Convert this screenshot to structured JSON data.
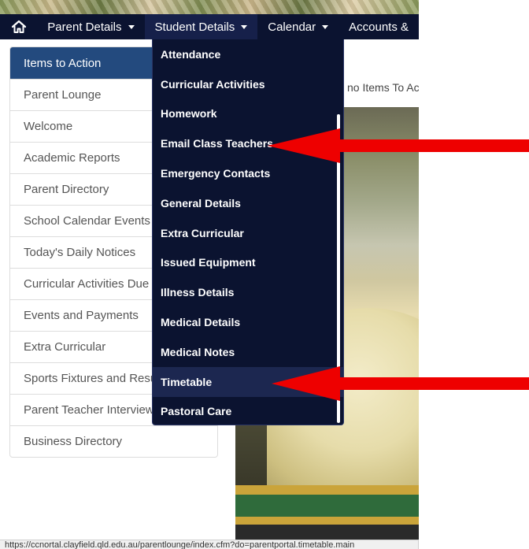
{
  "nav": {
    "items": [
      {
        "label": "Parent Details"
      },
      {
        "label": "Student Details"
      },
      {
        "label": "Calendar"
      },
      {
        "label": "Accounts &"
      }
    ]
  },
  "sidebar": {
    "items": [
      {
        "label": "Items to Action"
      },
      {
        "label": "Parent Lounge"
      },
      {
        "label": "Welcome"
      },
      {
        "label": "Academic Reports"
      },
      {
        "label": "Parent Directory"
      },
      {
        "label": "School Calendar Events"
      },
      {
        "label": "Today's Daily Notices"
      },
      {
        "label": "Curricular Activities Due"
      },
      {
        "label": "Events and Payments"
      },
      {
        "label": "Extra Curricular"
      },
      {
        "label": "Sports Fixtures and Results"
      },
      {
        "label": "Parent Teacher Interviews"
      },
      {
        "label": "Business Directory"
      }
    ]
  },
  "main": {
    "message": "no Items To Action"
  },
  "dropdown": {
    "items": [
      {
        "label": "Attendance"
      },
      {
        "label": "Curricular Activities"
      },
      {
        "label": "Homework"
      },
      {
        "label": "Email Class Teachers"
      },
      {
        "label": "Emergency Contacts"
      },
      {
        "label": "General Details"
      },
      {
        "label": "Extra Curricular"
      },
      {
        "label": "Issued Equipment"
      },
      {
        "label": "Illness Details"
      },
      {
        "label": "Medical Details"
      },
      {
        "label": "Medical Notes"
      },
      {
        "label": "Timetable"
      },
      {
        "label": "Pastoral Care"
      }
    ]
  },
  "statusbar": {
    "url": "https://ccnortal.clayfield.qld.edu.au/parentlounge/index.cfm?do=parentportal.timetable.main"
  },
  "colors": {
    "navbar": "#0b1330",
    "sidebar_active": "#234a7e",
    "arrow": "#ee0000"
  },
  "icons": {
    "home": "home-icon",
    "caret": "caret-down-icon",
    "arrow": "red-arrow-left"
  }
}
